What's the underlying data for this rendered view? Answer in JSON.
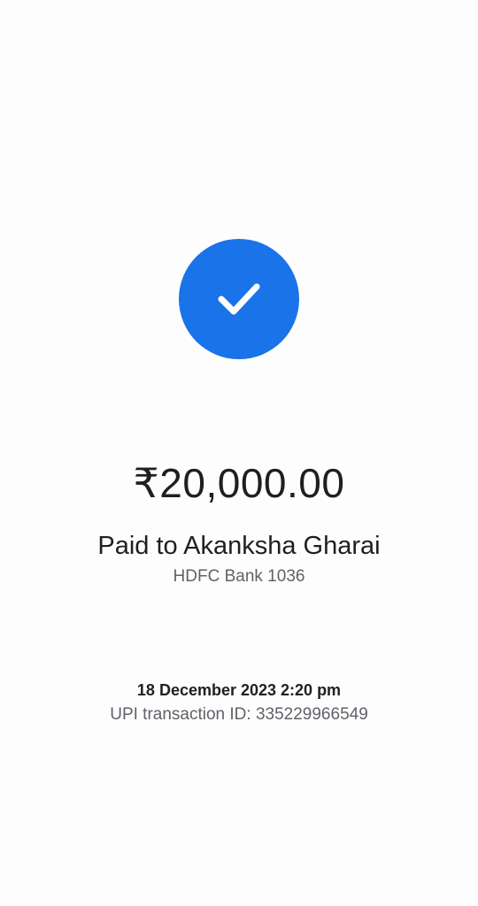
{
  "status": {
    "icon": "check-icon",
    "accent_color": "#1a73e8"
  },
  "payment": {
    "amount": "₹20,000.00",
    "paid_to": "Paid to Akanksha Gharai",
    "bank": "HDFC Bank 1036"
  },
  "transaction": {
    "datetime": "18 December 2023 2:20 pm",
    "upi_id": "UPI transaction ID: 335229966549"
  }
}
